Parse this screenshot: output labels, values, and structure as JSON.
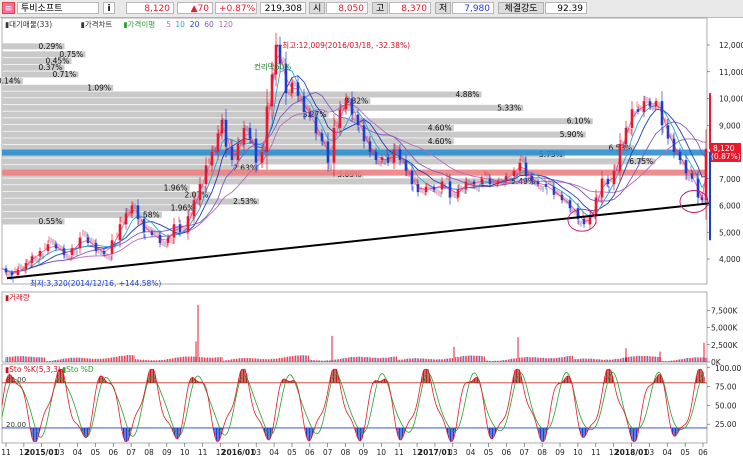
{
  "topbar": {
    "stock_name": "투비소프트",
    "info_icon": "i",
    "price": "8,120",
    "change": "▲70",
    "change_pct": "+0.87%",
    "volume": "219,308",
    "open_label": "시",
    "open": "8,050",
    "high_label": "고",
    "high": "8,370",
    "low_label": "저",
    "low": "7,980",
    "strength_label": "체결강도",
    "strength": "92.39"
  },
  "chart_data": [
    {
      "type": "line",
      "title": "",
      "legend": [
        "대기매물(33)",
        "가격차트",
        "가격이평",
        "5",
        "10",
        "20",
        "60",
        "120"
      ],
      "x_tick_labels": [
        "11",
        "12",
        "2015/01",
        "03",
        "04",
        "05",
        "06",
        "07",
        "08",
        "09",
        "10",
        "11",
        "12",
        "2016/01",
        "03",
        "04",
        "05",
        "06",
        "07",
        "08",
        "09",
        "10",
        "11",
        "12",
        "2017/01",
        "03",
        "04",
        "05",
        "06",
        "07",
        "08",
        "09",
        "10",
        "11",
        "12",
        "2018/01",
        "03",
        "04",
        "05",
        "06"
      ],
      "y_ticks": [
        4000,
        5000,
        6000,
        7000,
        8000,
        9000,
        10000,
        11000,
        12000
      ],
      "ylim": [
        2700,
        12700
      ],
      "colors": {
        "up": "#e8192c",
        "down": "#1a3fcf",
        "ma5": "#ff5aa0",
        "ma10": "#27a6d8",
        "ma20": "#1f3fbf",
        "ma60": "#7b5ec2",
        "ma120": "#b46bb8"
      },
      "close_series": [
        {
          "x": 0,
          "y": 3650
        },
        {
          "x": 4,
          "y": 3500
        },
        {
          "x": 10,
          "y": 3400
        },
        {
          "x": 16,
          "y": 3600
        },
        {
          "x": 24,
          "y": 3850
        },
        {
          "x": 30,
          "y": 4100
        },
        {
          "x": 38,
          "y": 4300
        },
        {
          "x": 46,
          "y": 4550
        },
        {
          "x": 54,
          "y": 4400
        },
        {
          "x": 62,
          "y": 4150
        },
        {
          "x": 70,
          "y": 4400
        },
        {
          "x": 78,
          "y": 4800
        },
        {
          "x": 86,
          "y": 4600
        },
        {
          "x": 94,
          "y": 4300
        },
        {
          "x": 102,
          "y": 4200
        },
        {
          "x": 110,
          "y": 4700
        },
        {
          "x": 118,
          "y": 5300
        },
        {
          "x": 124,
          "y": 5700
        },
        {
          "x": 130,
          "y": 6000
        },
        {
          "x": 136,
          "y": 5500
        },
        {
          "x": 142,
          "y": 5000
        },
        {
          "x": 150,
          "y": 4900
        },
        {
          "x": 158,
          "y": 4600
        },
        {
          "x": 166,
          "y": 4800
        },
        {
          "x": 172,
          "y": 5300
        },
        {
          "x": 178,
          "y": 5000
        },
        {
          "x": 186,
          "y": 5600
        },
        {
          "x": 192,
          "y": 6200
        },
        {
          "x": 198,
          "y": 6800
        },
        {
          "x": 204,
          "y": 7500
        },
        {
          "x": 210,
          "y": 8000
        },
        {
          "x": 216,
          "y": 8700
        },
        {
          "x": 220,
          "y": 9200
        },
        {
          "x": 224,
          "y": 8200
        },
        {
          "x": 230,
          "y": 7700
        },
        {
          "x": 236,
          "y": 8300
        },
        {
          "x": 242,
          "y": 8900
        },
        {
          "x": 248,
          "y": 8500
        },
        {
          "x": 254,
          "y": 7600
        },
        {
          "x": 260,
          "y": 8000
        },
        {
          "x": 265,
          "y": 9700
        },
        {
          "x": 270,
          "y": 10900
        },
        {
          "x": 274,
          "y": 12009
        },
        {
          "x": 278,
          "y": 11300
        },
        {
          "x": 284,
          "y": 10200
        },
        {
          "x": 290,
          "y": 10600
        },
        {
          "x": 296,
          "y": 10100
        },
        {
          "x": 302,
          "y": 9500
        },
        {
          "x": 308,
          "y": 9300
        },
        {
          "x": 314,
          "y": 8700
        },
        {
          "x": 320,
          "y": 8400
        },
        {
          "x": 326,
          "y": 7600
        },
        {
          "x": 332,
          "y": 8900
        },
        {
          "x": 338,
          "y": 9600
        },
        {
          "x": 344,
          "y": 10000
        },
        {
          "x": 350,
          "y": 9400
        },
        {
          "x": 356,
          "y": 9000
        },
        {
          "x": 362,
          "y": 8400
        },
        {
          "x": 368,
          "y": 8000
        },
        {
          "x": 374,
          "y": 7700
        },
        {
          "x": 380,
          "y": 7800
        },
        {
          "x": 386,
          "y": 7600
        },
        {
          "x": 392,
          "y": 8100
        },
        {
          "x": 398,
          "y": 7700
        },
        {
          "x": 404,
          "y": 7300
        },
        {
          "x": 410,
          "y": 6800
        },
        {
          "x": 416,
          "y": 6500
        },
        {
          "x": 424,
          "y": 6700
        },
        {
          "x": 432,
          "y": 6600
        },
        {
          "x": 440,
          "y": 6900
        },
        {
          "x": 448,
          "y": 6300
        },
        {
          "x": 456,
          "y": 6600
        },
        {
          "x": 464,
          "y": 6900
        },
        {
          "x": 472,
          "y": 6800
        },
        {
          "x": 480,
          "y": 7000
        },
        {
          "x": 488,
          "y": 6800
        },
        {
          "x": 496,
          "y": 6900
        },
        {
          "x": 504,
          "y": 7100
        },
        {
          "x": 512,
          "y": 7300
        },
        {
          "x": 518,
          "y": 7600
        },
        {
          "x": 524,
          "y": 7100
        },
        {
          "x": 530,
          "y": 6900
        },
        {
          "x": 536,
          "y": 6800
        },
        {
          "x": 544,
          "y": 6700
        },
        {
          "x": 552,
          "y": 6400
        },
        {
          "x": 560,
          "y": 6200
        },
        {
          "x": 568,
          "y": 5900
        },
        {
          "x": 576,
          "y": 5500
        },
        {
          "x": 582,
          "y": 5300
        },
        {
          "x": 588,
          "y": 5600
        },
        {
          "x": 594,
          "y": 6300
        },
        {
          "x": 600,
          "y": 7000
        },
        {
          "x": 606,
          "y": 6800
        },
        {
          "x": 612,
          "y": 7300
        },
        {
          "x": 618,
          "y": 8300
        },
        {
          "x": 624,
          "y": 8900
        },
        {
          "x": 630,
          "y": 9600
        },
        {
          "x": 636,
          "y": 9500
        },
        {
          "x": 642,
          "y": 9900
        },
        {
          "x": 648,
          "y": 9700
        },
        {
          "x": 654,
          "y": 9900
        },
        {
          "x": 660,
          "y": 9000
        },
        {
          "x": 666,
          "y": 8500
        },
        {
          "x": 672,
          "y": 8000
        },
        {
          "x": 678,
          "y": 7700
        },
        {
          "x": 684,
          "y": 7200
        },
        {
          "x": 690,
          "y": 7000
        },
        {
          "x": 696,
          "y": 6300
        },
        {
          "x": 700,
          "y": 6200
        },
        {
          "x": 704,
          "y": 8120
        }
      ],
      "trendline": [
        {
          "x": 5,
          "y": 3280
        },
        {
          "x": 707,
          "y": 6080
        }
      ],
      "horizontal_levels": [
        {
          "y": 7980,
          "color": "#2a8fd0",
          "label": "5.90%"
        },
        {
          "y": 7230,
          "color": "#f08080",
          "label": "5.73%"
        }
      ],
      "volume_profile": [
        {
          "price": 11950,
          "pct": "0.29%",
          "width": 0.09
        },
        {
          "price": 11650,
          "pct": "0.75%",
          "width": 0.12
        },
        {
          "price": 11400,
          "pct": "0.45%",
          "width": 0.1
        },
        {
          "price": 11150,
          "pct": "0.37%",
          "width": 0.09
        },
        {
          "price": 10900,
          "pct": "0.71%",
          "width": 0.11
        },
        {
          "price": 10650,
          "pct": "0.14%",
          "width": 0.03
        },
        {
          "price": 10400,
          "pct": "1.09%",
          "width": 0.16
        },
        {
          "price": 10150,
          "pct": "4.88%",
          "width": 0.69
        },
        {
          "price": 9900,
          "pct": "3.32%",
          "width": 0.53
        },
        {
          "price": 9650,
          "pct": "5.33%",
          "width": 0.75
        },
        {
          "price": 9400,
          "pct": "3.27%",
          "width": 0.47
        },
        {
          "price": 9150,
          "pct": "6.10%",
          "width": 0.85
        },
        {
          "price": 8900,
          "pct": "4.60%",
          "width": 0.65
        },
        {
          "price": 8650,
          "pct": "5.90%",
          "width": 0.84
        },
        {
          "price": 8400,
          "pct": "4.60%",
          "width": 0.65
        },
        {
          "price": 8150,
          "pct": "6.53%",
          "width": 0.91
        },
        {
          "price": 7900,
          "pct": "5.73%",
          "width": 0.81
        },
        {
          "price": 7650,
          "pct": "6.75%",
          "width": 0.94
        },
        {
          "price": 7400,
          "pct": "2.63%",
          "width": 0.37
        },
        {
          "price": 7150,
          "pct": "3.69%",
          "width": 0.52
        },
        {
          "price": 6900,
          "pct": "5.49%",
          "width": 0.77
        },
        {
          "price": 6650,
          "pct": "1.96%",
          "width": 0.27
        },
        {
          "price": 6400,
          "pct": "2.07%",
          "width": 0.3
        },
        {
          "price": 6150,
          "pct": "2.53%",
          "width": 0.37
        },
        {
          "price": 5900,
          "pct": "1.96%",
          "width": 0.28
        },
        {
          "price": 5650,
          "pct": "1.58%",
          "width": 0.23
        },
        {
          "price": 5400,
          "pct": "0.55%",
          "width": 0.09
        }
      ],
      "annotations": {
        "high": "←최고:12,009(2016/03/18, -32.38%)",
        "low": "최저:3,320(2014/12/16, +144.58%)",
        "peak_text": "컨리막60%",
        "price_tag": "8,120",
        "price_tag_pct": "(0.87%)"
      }
    },
    {
      "type": "bar",
      "title": "거래량",
      "y_ticks": [
        "7,500K",
        "5,000K",
        "2,500K",
        "0K"
      ],
      "y_tick_values": [
        7500,
        5000,
        2500,
        0
      ],
      "ylim": [
        0,
        9000
      ],
      "spikes": [
        {
          "x": 196,
          "value": 8300
        },
        {
          "x": 194,
          "value": 3000
        },
        {
          "x": 330,
          "value": 3800
        },
        {
          "x": 452,
          "value": 2200
        },
        {
          "x": 516,
          "value": 3600
        },
        {
          "x": 624,
          "value": 2000
        },
        {
          "x": 658,
          "value": 1500
        },
        {
          "x": 702,
          "value": 2800
        }
      ]
    },
    {
      "type": "line",
      "title": "",
      "legend": [
        "Sto %K(5,3,3)",
        "Sto %D"
      ],
      "y_ticks": [
        "100.00",
        "75.00",
        "50.00",
        "25.00"
      ],
      "y_tick_values": [
        100,
        75,
        50,
        25
      ],
      "ylim": [
        0,
        105
      ],
      "levels": [
        {
          "y": 80,
          "label": "80.00"
        },
        {
          "y": 20,
          "label": "20.00"
        }
      ]
    }
  ]
}
